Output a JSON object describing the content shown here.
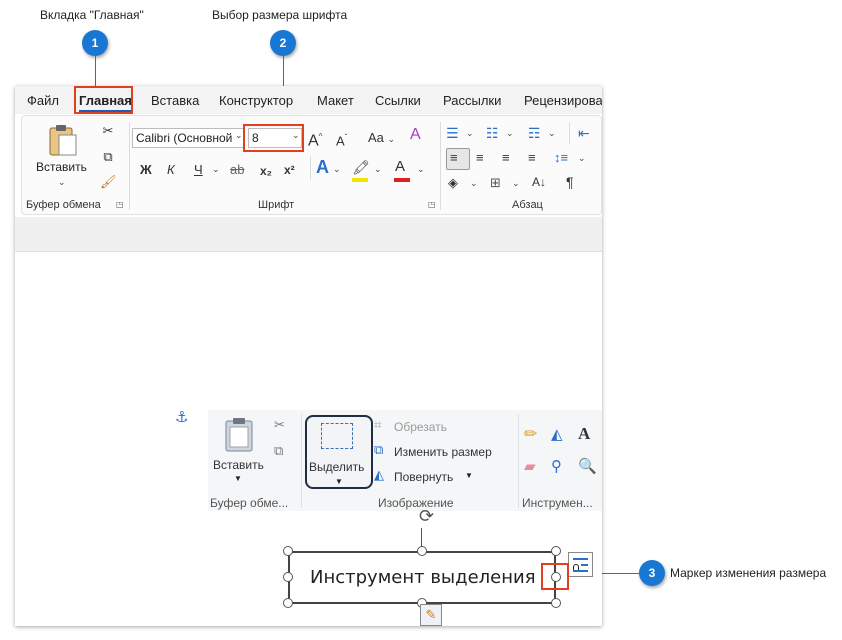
{
  "callouts": [
    {
      "num": "1",
      "label": "Вкладка \"Главная\""
    },
    {
      "num": "2",
      "label": "Выбор размера шрифта"
    },
    {
      "num": "3",
      "label": "Маркер изменения размера"
    }
  ],
  "tabs": [
    "Файл",
    "Главная",
    "Вставка",
    "Конструктор",
    "Макет",
    "Ссылки",
    "Рассылки",
    "Рецензирова"
  ],
  "ribbon": {
    "clipboard": {
      "paste_label": "Вставить",
      "group_label": "Буфер обмена"
    },
    "font": {
      "font_name": "Calibri (Основной",
      "font_size": "8",
      "case_label": "Aa",
      "group_label": "Шрифт",
      "bold": "Ж",
      "italic": "К",
      "underline": "Ч",
      "strike": "ab",
      "sub": "x₂",
      "sup": "x²",
      "grow": "A",
      "shrink": "A"
    },
    "paragraph": {
      "group_label": "Абзац"
    }
  },
  "paint": {
    "paste_label": "Вставить",
    "select_label": "Выделить",
    "crop_label": "Обрезать",
    "resize_label": "Изменить размер",
    "rotate_label": "Повернуть",
    "clipboard_group": "Буфер обме...",
    "image_group": "Изображение",
    "tools_group": "Инструмен..."
  },
  "textbox": {
    "text": "Инструмент выделения"
  },
  "colors": {
    "callout": "#1877d2",
    "highlight_box": "#e0401f",
    "highlight_color": "#f2e600",
    "font_color": "#e02020"
  },
  "icons": [
    "anchor-icon",
    "rotate-handle-icon",
    "layout-options-icon",
    "edit-icon",
    "cut-icon",
    "copy-icon",
    "format-painter-icon"
  ]
}
